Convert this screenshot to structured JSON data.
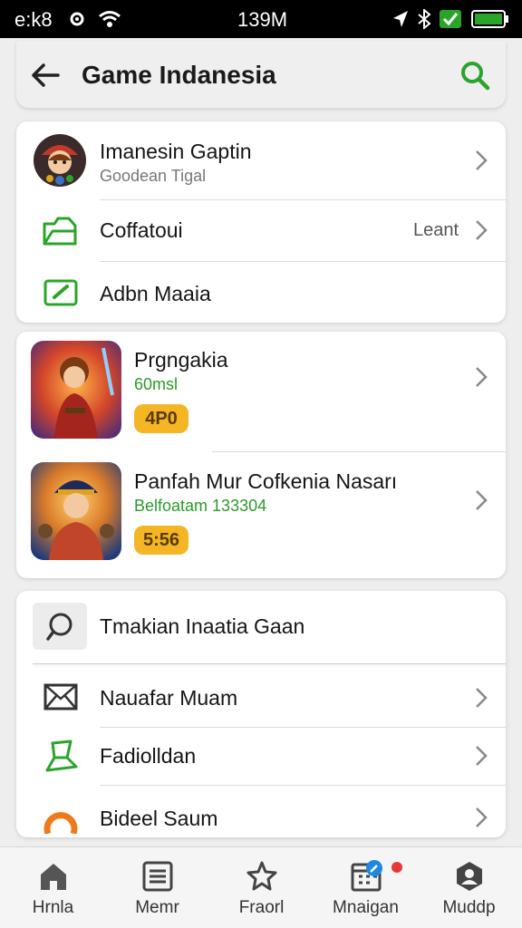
{
  "status_bar": {
    "left_text": "e:k8",
    "time": "139M",
    "icons": [
      "settings-gear-icon",
      "wifi-icon",
      "location-arrow-icon",
      "bluetooth-icon",
      "check-icon",
      "battery-icon"
    ],
    "accent_color": "#2aa52a"
  },
  "header": {
    "title": "Game Indanesia",
    "back_icon": "back-arrow-icon",
    "search_icon": "search-icon",
    "accent_color": "#2aa52a"
  },
  "account_card": {
    "profile": {
      "name": "Imanesin Gaptin",
      "subtitle": "Goodean Tigal"
    },
    "row2": {
      "label": "Coffatoui",
      "value": "Leant"
    },
    "row3": {
      "label": "Adbn Maaia"
    }
  },
  "games_card": {
    "items": [
      {
        "title": "Prgngakia",
        "subtitle": "60msl",
        "badge": "4P0"
      },
      {
        "title": "Panfah Mur Cofkenia Nasarı",
        "subtitle": "Belfoatam 133304",
        "badge": "5:56"
      }
    ],
    "badge_color": "#f5b625"
  },
  "menu_card": {
    "search_item": {
      "label": "Tmakian Inaatia Gaan"
    },
    "items": [
      {
        "label": "Nauafar Muam",
        "icon": "mail-icon"
      },
      {
        "label": "Fadiolldan",
        "icon": "boot-icon"
      },
      {
        "label": "Bideel Saum",
        "icon": "ring-icon"
      }
    ]
  },
  "bottom_nav": {
    "items": [
      {
        "label": "Hrnla",
        "icon": "home-icon"
      },
      {
        "label": "Memr",
        "icon": "menu-icon"
      },
      {
        "label": "Fraorl",
        "icon": "star-icon"
      },
      {
        "label": "Mnaigan",
        "icon": "calendar-icon"
      },
      {
        "label": "Muddp",
        "icon": "profile-icon"
      }
    ]
  }
}
